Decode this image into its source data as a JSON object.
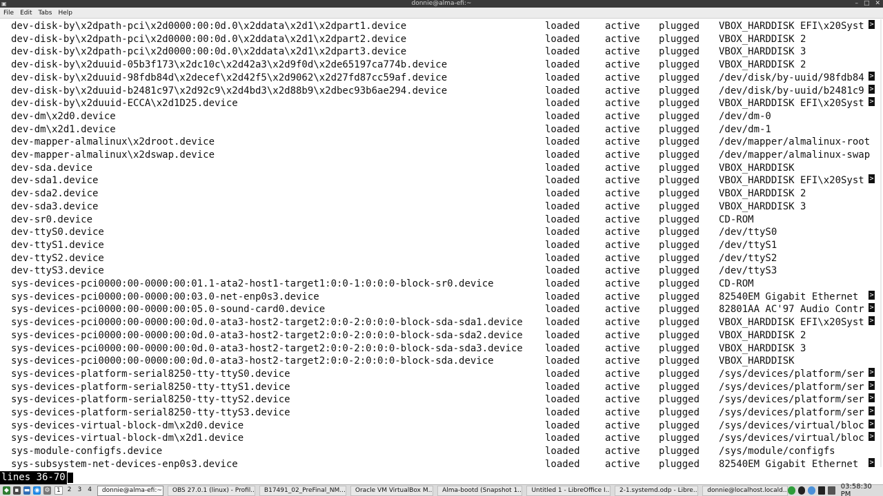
{
  "window": {
    "title": "donnie@alma-efi:~"
  },
  "menu": [
    "File",
    "Edit",
    "Tabs",
    "Help"
  ],
  "rows": [
    [
      "dev-disk-by\\x2dpath-pci\\x2d0000:00:0d.0\\x2ddata\\x2d1\\x2dpart1.device",
      "loaded",
      "active",
      "plugged",
      "VBOX_HARDDISK EFI\\x20Syst",
      true
    ],
    [
      "dev-disk-by\\x2dpath-pci\\x2d0000:00:0d.0\\x2ddata\\x2d1\\x2dpart2.device",
      "loaded",
      "active",
      "plugged",
      "VBOX_HARDDISK 2",
      false
    ],
    [
      "dev-disk-by\\x2dpath-pci\\x2d0000:00:0d.0\\x2ddata\\x2d1\\x2dpart3.device",
      "loaded",
      "active",
      "plugged",
      "VBOX_HARDDISK 3",
      false
    ],
    [
      "dev-disk-by\\x2duuid-05b3f173\\x2dc10c\\x2d42a3\\x2d9f0d\\x2de65197ca774b.device",
      "loaded",
      "active",
      "plugged",
      "VBOX_HARDDISK 2",
      false
    ],
    [
      "dev-disk-by\\x2duuid-98fdb84d\\x2decef\\x2d42f5\\x2d9062\\x2d27fd87cc59af.device",
      "loaded",
      "active",
      "plugged",
      "/dev/disk/by-uuid/98fdb84",
      true
    ],
    [
      "dev-disk-by\\x2duuid-b2481c97\\x2d92c9\\x2d4bd3\\x2d88b9\\x2dbec93b6ae294.device",
      "loaded",
      "active",
      "plugged",
      "/dev/disk/by-uuid/b2481c9",
      true
    ],
    [
      "dev-disk-by\\x2duuid-ECCA\\x2d1D25.device",
      "loaded",
      "active",
      "plugged",
      "VBOX_HARDDISK EFI\\x20Syst",
      true
    ],
    [
      "dev-dm\\x2d0.device",
      "loaded",
      "active",
      "plugged",
      "/dev/dm-0",
      false
    ],
    [
      "dev-dm\\x2d1.device",
      "loaded",
      "active",
      "plugged",
      "/dev/dm-1",
      false
    ],
    [
      "dev-mapper-almalinux\\x2droot.device",
      "loaded",
      "active",
      "plugged",
      "/dev/mapper/almalinux-root",
      false
    ],
    [
      "dev-mapper-almalinux\\x2dswap.device",
      "loaded",
      "active",
      "plugged",
      "/dev/mapper/almalinux-swap",
      false
    ],
    [
      "dev-sda.device",
      "loaded",
      "active",
      "plugged",
      "VBOX_HARDDISK",
      false
    ],
    [
      "dev-sda1.device",
      "loaded",
      "active",
      "plugged",
      "VBOX_HARDDISK EFI\\x20Syst",
      true
    ],
    [
      "dev-sda2.device",
      "loaded",
      "active",
      "plugged",
      "VBOX_HARDDISK 2",
      false
    ],
    [
      "dev-sda3.device",
      "loaded",
      "active",
      "plugged",
      "VBOX_HARDDISK 3",
      false
    ],
    [
      "dev-sr0.device",
      "loaded",
      "active",
      "plugged",
      "CD-ROM",
      false
    ],
    [
      "dev-ttyS0.device",
      "loaded",
      "active",
      "plugged",
      "/dev/ttyS0",
      false
    ],
    [
      "dev-ttyS1.device",
      "loaded",
      "active",
      "plugged",
      "/dev/ttyS1",
      false
    ],
    [
      "dev-ttyS2.device",
      "loaded",
      "active",
      "plugged",
      "/dev/ttyS2",
      false
    ],
    [
      "dev-ttyS3.device",
      "loaded",
      "active",
      "plugged",
      "/dev/ttyS3",
      false
    ],
    [
      "sys-devices-pci0000:00-0000:00:01.1-ata2-host1-target1:0:0-1:0:0:0-block-sr0.device",
      "loaded",
      "active",
      "plugged",
      "CD-ROM",
      false
    ],
    [
      "sys-devices-pci0000:00-0000:00:03.0-net-enp0s3.device",
      "loaded",
      "active",
      "plugged",
      "82540EM Gigabit Ethernet",
      true
    ],
    [
      "sys-devices-pci0000:00-0000:00:05.0-sound-card0.device",
      "loaded",
      "active",
      "plugged",
      "82801AA AC'97 Audio Contr",
      true
    ],
    [
      "sys-devices-pci0000:00-0000:00:0d.0-ata3-host2-target2:0:0-2:0:0:0-block-sda-sda1.device",
      "loaded",
      "active",
      "plugged",
      "VBOX_HARDDISK EFI\\x20Syst",
      true
    ],
    [
      "sys-devices-pci0000:00-0000:00:0d.0-ata3-host2-target2:0:0-2:0:0:0-block-sda-sda2.device",
      "loaded",
      "active",
      "plugged",
      "VBOX_HARDDISK 2",
      false
    ],
    [
      "sys-devices-pci0000:00-0000:00:0d.0-ata3-host2-target2:0:0-2:0:0:0-block-sda-sda3.device",
      "loaded",
      "active",
      "plugged",
      "VBOX_HARDDISK 3",
      false
    ],
    [
      "sys-devices-pci0000:00-0000:00:0d.0-ata3-host2-target2:0:0-2:0:0:0-block-sda.device",
      "loaded",
      "active",
      "plugged",
      "VBOX_HARDDISK",
      false
    ],
    [
      "sys-devices-platform-serial8250-tty-ttyS0.device",
      "loaded",
      "active",
      "plugged",
      "/sys/devices/platform/ser",
      true
    ],
    [
      "sys-devices-platform-serial8250-tty-ttyS1.device",
      "loaded",
      "active",
      "plugged",
      "/sys/devices/platform/ser",
      true
    ],
    [
      "sys-devices-platform-serial8250-tty-ttyS2.device",
      "loaded",
      "active",
      "plugged",
      "/sys/devices/platform/ser",
      true
    ],
    [
      "sys-devices-platform-serial8250-tty-ttyS3.device",
      "loaded",
      "active",
      "plugged",
      "/sys/devices/platform/ser",
      true
    ],
    [
      "sys-devices-virtual-block-dm\\x2d0.device",
      "loaded",
      "active",
      "plugged",
      "/sys/devices/virtual/bloc",
      true
    ],
    [
      "sys-devices-virtual-block-dm\\x2d1.device",
      "loaded",
      "active",
      "plugged",
      "/sys/devices/virtual/bloc",
      true
    ],
    [
      "sys-module-configfs.device",
      "loaded",
      "active",
      "plugged",
      "/sys/module/configfs",
      false
    ],
    [
      "sys-subsystem-net-devices-enp0s3.device",
      "loaded",
      "active",
      "plugged",
      "82540EM Gigabit Ethernet",
      true
    ]
  ],
  "truncation_marker": ">",
  "pager": {
    "status": "lines 36-70"
  },
  "taskbar": {
    "desktops": [
      "1",
      "2",
      "3",
      "4"
    ],
    "active_desktop": 0,
    "tasks": [
      {
        "label": "donnie@alma-efi:~",
        "icon": "terminal-icon",
        "color": "#2b2b2b",
        "active": true
      },
      {
        "label": "OBS 27.0.1 (linux) - Profil...",
        "icon": "obs-icon",
        "color": "#333333",
        "active": false
      },
      {
        "label": "B17491_02_PreFinal_NM....",
        "icon": "document-icon",
        "color": "#3a6fb0",
        "active": false
      },
      {
        "label": "Oracle VM VirtualBox M...",
        "icon": "virtualbox-icon",
        "color": "#1f5aa8",
        "active": false
      },
      {
        "label": "Alma-bootd (Snapshot 1...",
        "icon": "virtualbox-icon",
        "color": "#1f5aa8",
        "active": false
      },
      {
        "label": "Untitled 1 - LibreOffice I...",
        "icon": "libreoffice-impress-icon",
        "color": "#d9581c",
        "active": false
      },
      {
        "label": "2-1.systemd.odp - Libre...",
        "icon": "libreoffice-impress-icon",
        "color": "#d9581c",
        "active": false
      },
      {
        "label": "donnie@localhost.locald...",
        "icon": "terminal-icon",
        "color": "#2b2b2b",
        "active": false
      }
    ],
    "clock": "03:58:30 PM"
  }
}
